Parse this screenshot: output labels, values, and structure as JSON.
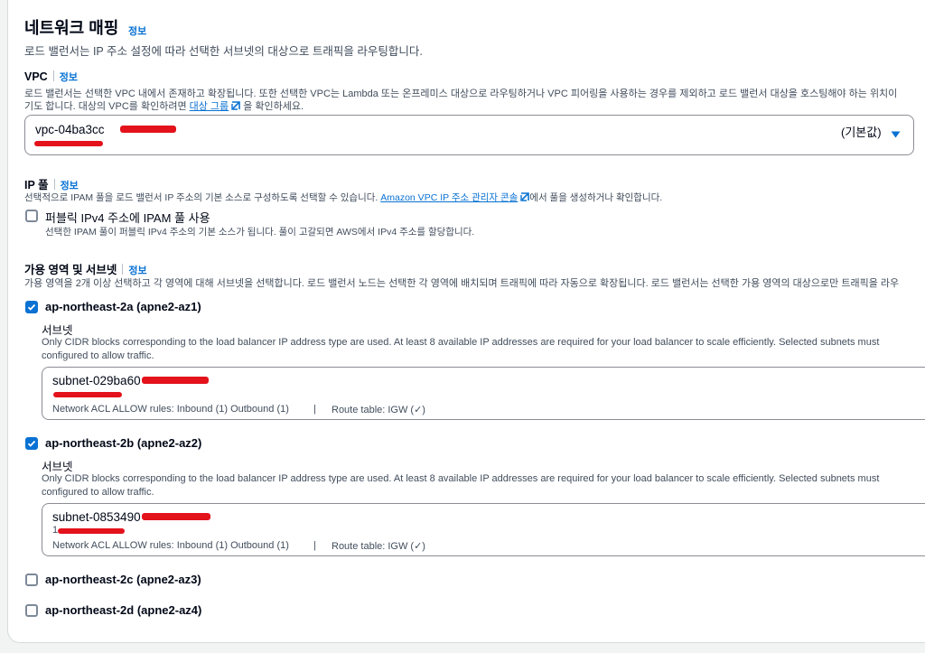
{
  "section": {
    "title": "네트워크 매핑",
    "info": "정보",
    "description": "로드 밸런서는 IP 주소 설정에 따라 선택한 서브넷의 대상으로 트래픽을 라우팅합니다."
  },
  "vpc": {
    "label": "VPC",
    "info": "정보",
    "desc_line1": "로드 밸런서는 선택한 VPC 내에서 존재하고 확장됩니다. 또한 선택한 VPC는 Lambda 또는 온프레미스 대상으로 라우팅하거나 VPC 피어링을 사용하는 경우를 제외하고 로드 밸런서 대상을 호스팅해야 하는 위치이",
    "desc_line2_prefix": "기도 합니다. 대상의 VPC를 확인하려면",
    "desc_link": "대상 그룹",
    "desc_line2_suffix": "을 확인하세요.",
    "selected_value": "vpc-04ba3cc",
    "default_tag": "(기본값)"
  },
  "ip_pool": {
    "label": "IP 풀",
    "info": "정보",
    "desc_prefix": "선택적으로 IPAM 풀을 로드 밸런서 IP 주소의 기본 소스로 구성하도록 선택할 수 있습니다.",
    "desc_link": "Amazon VPC IP 주소 관리자 콘솔",
    "desc_suffix": "에서 풀을 생성하거나 확인합니다.",
    "checkbox_label": "퍼블릭 IPv4 주소에 IPAM 풀 사용",
    "checkbox_desc": "선택한 IPAM 풀이 퍼블릭 IPv4 주소의 기본 소스가 됩니다. 풀이 고갈되면 AWS에서 IPv4 주소를 할당합니다."
  },
  "azs": {
    "label": "가용 영역 및 서브넷",
    "info": "정보",
    "description": "가용 영역을 2개 이상 선택하고 각 영역에 대해 서브넷을 선택합니다. 로드 밸런서 노드는 선택한 각 영역에 배치되며 트래픽에 따라 자동으로 확장됩니다. 로드 밸런서는 선택한 가용 영역의 대상으로만 트래픽을 라우",
    "items": [
      {
        "name": "ap-northeast-2a (apne2-az1)",
        "checked": true,
        "subnet_label": "서브넷",
        "subnet_desc_1": "Only CIDR blocks corresponding to the load balancer IP address type are used. At least 8 available IP addresses are required for your load balancer to scale efficiently. Selected subnets must",
        "subnet_desc_2": "configured to allow traffic.",
        "subnet_value": "subnet-029ba60",
        "acl": "Network ACL ALLOW rules: Inbound (1) Outbound (1)",
        "divider": "|",
        "route": "Route table: IGW (✓)"
      },
      {
        "name": "ap-northeast-2b (apne2-az2)",
        "checked": true,
        "subnet_label": "서브넷",
        "subnet_desc_1": "Only CIDR blocks corresponding to the load balancer IP address type are used. At least 8 available IP addresses are required for your load balancer to scale efficiently. Selected subnets must",
        "subnet_desc_2": "configured to allow traffic.",
        "subnet_value": "subnet-0853490",
        "subnet_sub_prefix": "1",
        "acl": "Network ACL ALLOW rules: Inbound (1) Outbound (1)",
        "divider": "|",
        "route": "Route table: IGW (✓)"
      },
      {
        "name": "ap-northeast-2c (apne2-az3)",
        "checked": false
      },
      {
        "name": "ap-northeast-2d (apne2-az4)",
        "checked": false
      }
    ]
  },
  "colors": {
    "link": "#0972d3",
    "checkbox_on": "#0972d3",
    "redaction": "#e3121b"
  }
}
